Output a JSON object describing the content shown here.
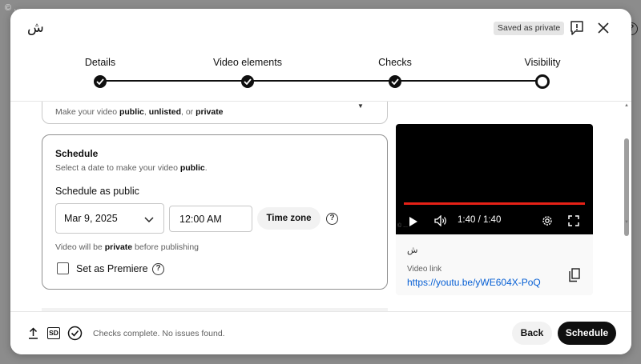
{
  "background": {
    "corner_text": "© ...",
    "help_glyph": "?"
  },
  "header": {
    "title": "ش",
    "saved_badge": "Saved as private",
    "feedback_icon": "feedback-icon",
    "close_icon": "close-icon"
  },
  "stepper": {
    "steps": [
      {
        "label": "Details",
        "state": "done"
      },
      {
        "label": "Video elements",
        "state": "done"
      },
      {
        "label": "Checks",
        "state": "done"
      },
      {
        "label": "Visibility",
        "state": "current"
      }
    ]
  },
  "visibility_card": {
    "desc_prefix": "Make your video ",
    "desc_public": "public",
    "desc_sep1": ", ",
    "desc_unlisted": "unlisted",
    "desc_sep2": ", or ",
    "desc_private": "private"
  },
  "schedule": {
    "title": "Schedule",
    "desc_prefix": "Select a date to make your video ",
    "desc_public": "public",
    "desc_suffix": ".",
    "schedule_as": "Schedule as public",
    "date": "Mar 9, 2025",
    "time": "12:00 AM",
    "timezone_button": "Time zone",
    "note_prefix": "Video will be ",
    "note_private": "private",
    "note_suffix": " before publishing",
    "premiere_label": "Set as Premiere",
    "premiere_checked": false,
    "help_glyph": "?"
  },
  "video": {
    "time": "1:40 / 1:40",
    "progress": 1.0,
    "watermark": "© ...",
    "title": "ش",
    "link_label": "Video link",
    "link": "https://youtu.be/yWE604X-PoQ"
  },
  "footer": {
    "sd_badge": "SD",
    "checks_text": "Checks complete. No issues found.",
    "back_label": "Back",
    "schedule_label": "Schedule"
  },
  "colors": {
    "accent_red": "#e62117",
    "link_blue": "#065fd4",
    "primary_dark": "#0f0f0f"
  }
}
